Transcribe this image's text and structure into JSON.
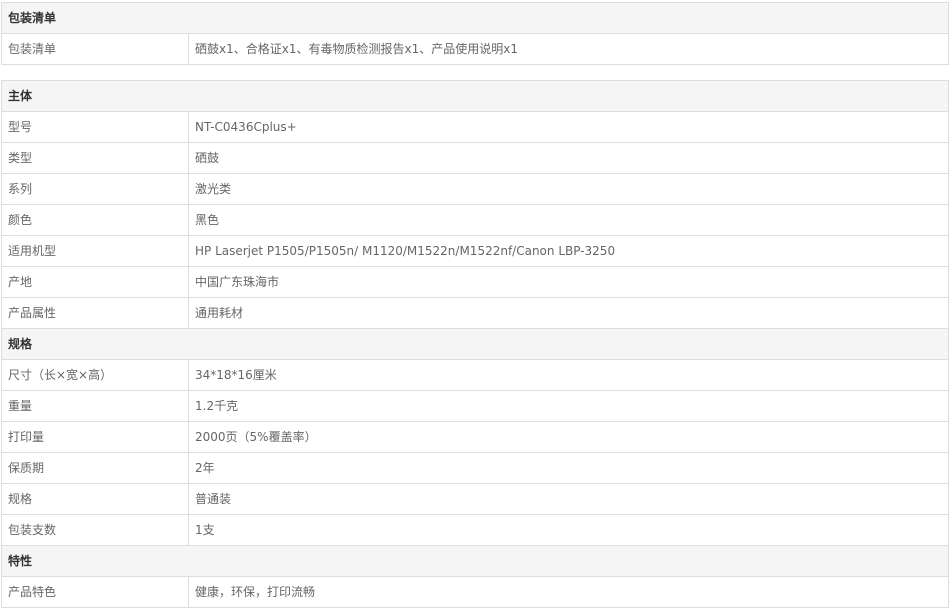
{
  "packing": {
    "title": "包装清单",
    "rows": [
      {
        "key": "包装清单",
        "value": "硒鼓x1、合格证x1、有毒物质检测报告x1、产品使用说明x1"
      }
    ]
  },
  "sections": [
    {
      "title": "主体",
      "rows": [
        {
          "key": "型号",
          "value": "NT-C0436Cplus+"
        },
        {
          "key": "类型",
          "value": "硒鼓"
        },
        {
          "key": "系列",
          "value": "激光类"
        },
        {
          "key": "颜色",
          "value": "黑色"
        },
        {
          "key": "适用机型",
          "value": "HP Laserjet P1505/P1505n/ M1120/M1522n/M1522nf/Canon LBP-3250"
        },
        {
          "key": "产地",
          "value": "中国广东珠海市"
        },
        {
          "key": "产品属性",
          "value": "通用耗材"
        }
      ]
    },
    {
      "title": "规格",
      "rows": [
        {
          "key": "尺寸（长×宽×高）",
          "value": "34*18*16厘米"
        },
        {
          "key": "重量",
          "value": "1.2千克"
        },
        {
          "key": "打印量",
          "value": "2000页（5%覆盖率）"
        },
        {
          "key": "保质期",
          "value": "2年"
        },
        {
          "key": "规格",
          "value": "普通装"
        },
        {
          "key": "包装支数",
          "value": "1支"
        }
      ]
    },
    {
      "title": "特性",
      "rows": [
        {
          "key": "产品特色",
          "value": "健康，环保，打印流畅"
        }
      ]
    }
  ],
  "colors": {
    "header_bg": "#f5f5f5",
    "border": "#dddddd",
    "text": "#666666",
    "header_text": "#333333"
  }
}
